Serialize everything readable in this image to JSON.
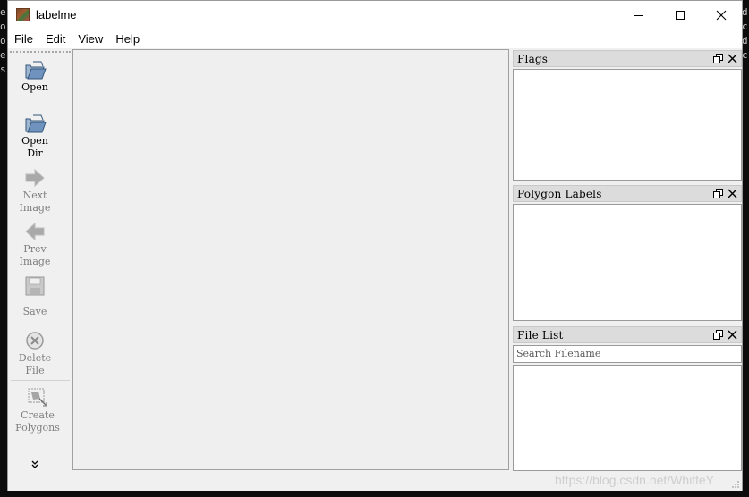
{
  "app": {
    "title": "labelme"
  },
  "menu": [
    {
      "label": "File"
    },
    {
      "label": "Edit"
    },
    {
      "label": "View"
    },
    {
      "label": "Help"
    }
  ],
  "toolbar": {
    "open": {
      "label": "Open",
      "icon": "folder-open-icon"
    },
    "open_dir": {
      "label_line1": "Open",
      "label_line2": "Dir",
      "icon": "folder-open-icon"
    },
    "next_image": {
      "label_line1": "Next",
      "label_line2": "Image",
      "icon": "arrow-right-icon",
      "enabled": false
    },
    "prev_image": {
      "label_line1": "Prev",
      "label_line2": "Image",
      "icon": "arrow-left-icon",
      "enabled": false
    },
    "save": {
      "label": "Save",
      "icon": "floppy-disk-icon",
      "enabled": false
    },
    "delete_file": {
      "label_line1": "Delete",
      "label_line2": "File",
      "icon": "delete-circle-icon",
      "enabled": false
    },
    "create_polygons": {
      "label_line1": "Create",
      "label_line2": "Polygons",
      "icon": "polygon-icon",
      "enabled": false
    },
    "more": {
      "icon": "double-chevron-down-icon"
    }
  },
  "docks": {
    "flags": {
      "title": "Flags"
    },
    "polygon_labels": {
      "title": "Polygon Labels"
    },
    "file_list": {
      "title": "File List",
      "search_placeholder": "Search Filename"
    }
  },
  "watermark": "https://blog.csdn.net/WhiffeY",
  "colors": {
    "window_bg": "#f0f0f0",
    "dock_title_bg": "#dcdcdc",
    "disabled_text": "#7f7f7f"
  }
}
